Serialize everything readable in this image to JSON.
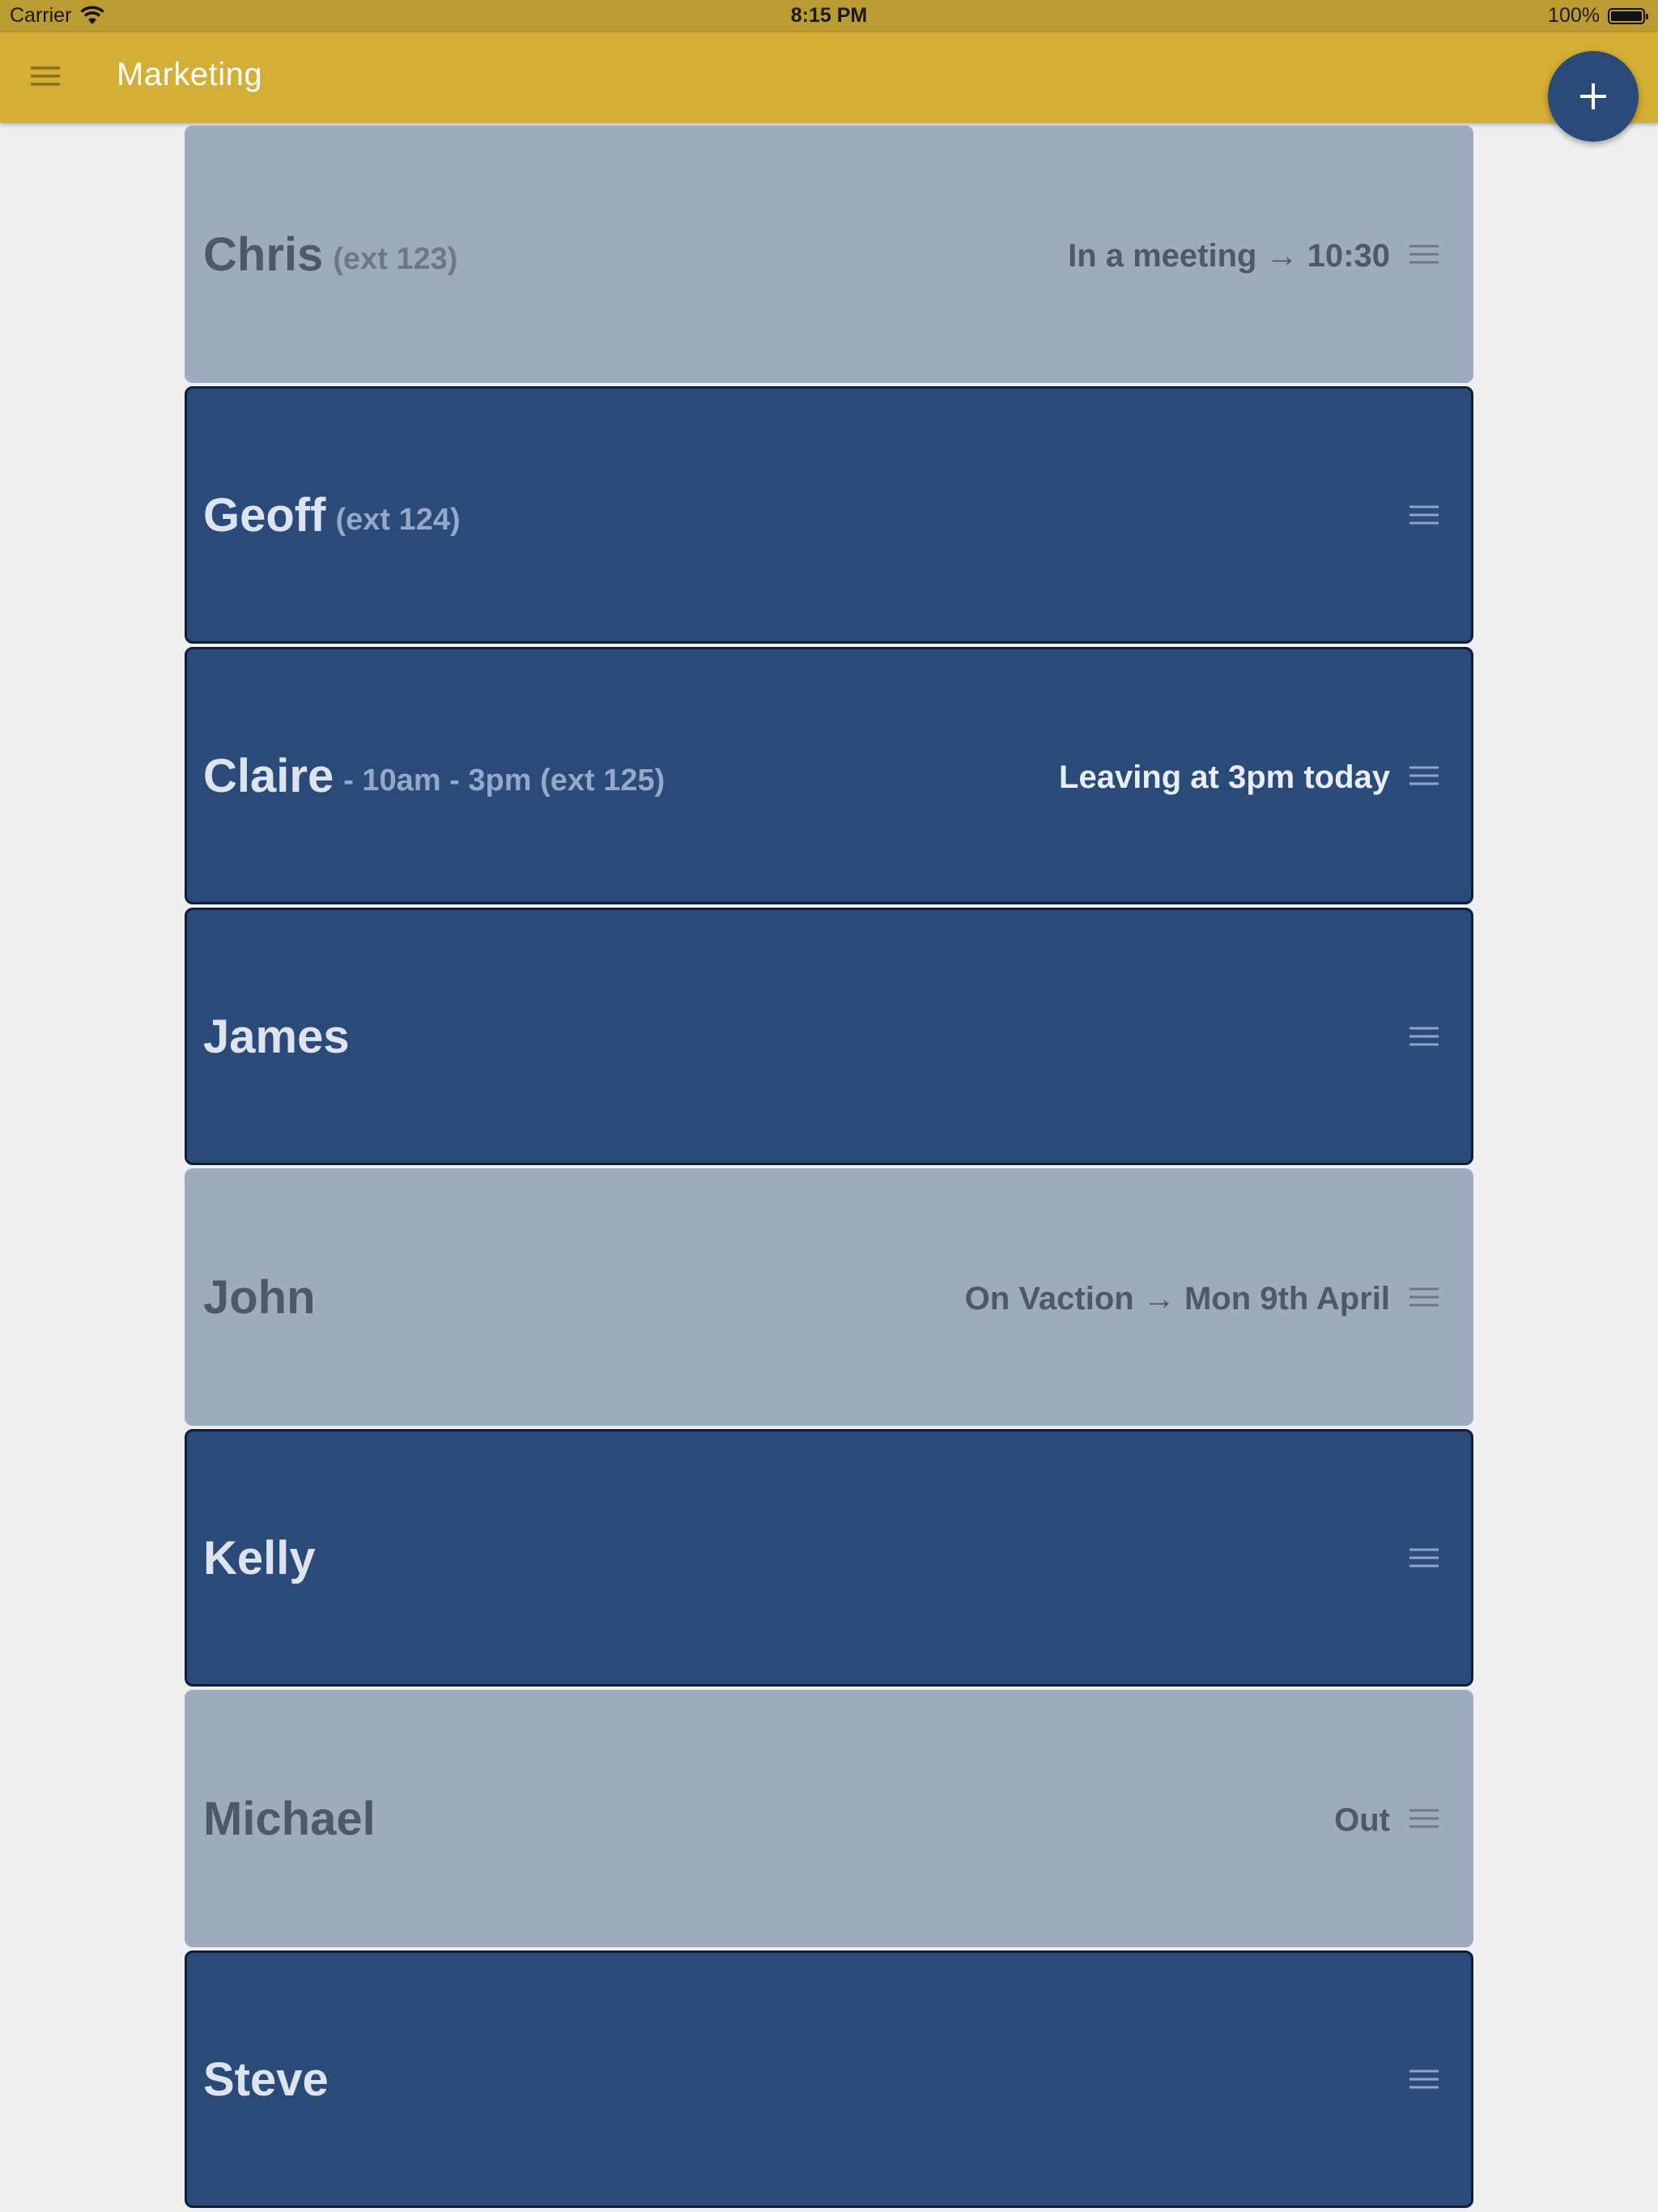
{
  "status_bar": {
    "carrier": "Carrier",
    "time": "8:15 PM",
    "battery": "100%"
  },
  "app_bar": {
    "title": "Marketing",
    "menu_icon": "hamburger-menu-icon",
    "fab_icon": "plus-icon"
  },
  "colors": {
    "app_bar": "#d4ae35",
    "status_bar": "#bb9c30",
    "available_card": "#2a4a79",
    "away_card": "#9eabbf",
    "fab": "#2a4a79",
    "background": "#efefef"
  },
  "people": [
    {
      "name": "Chris",
      "sub": "(ext 123)",
      "status": "In a meeting → 10:30",
      "state": "away"
    },
    {
      "name": "Geoff",
      "sub": "(ext 124)",
      "status": "",
      "state": "in"
    },
    {
      "name": "Claire",
      "sub": "- 10am - 3pm (ext 125)",
      "status": "Leaving at 3pm today",
      "state": "in"
    },
    {
      "name": "James",
      "sub": "",
      "status": "",
      "state": "in"
    },
    {
      "name": "John",
      "sub": "",
      "status": "On Vaction → Mon 9th April",
      "state": "away"
    },
    {
      "name": "Kelly",
      "sub": "",
      "status": "",
      "state": "in"
    },
    {
      "name": "Michael",
      "sub": "",
      "status": "Out",
      "state": "away"
    },
    {
      "name": "Steve",
      "sub": "",
      "status": "",
      "state": "in"
    }
  ]
}
